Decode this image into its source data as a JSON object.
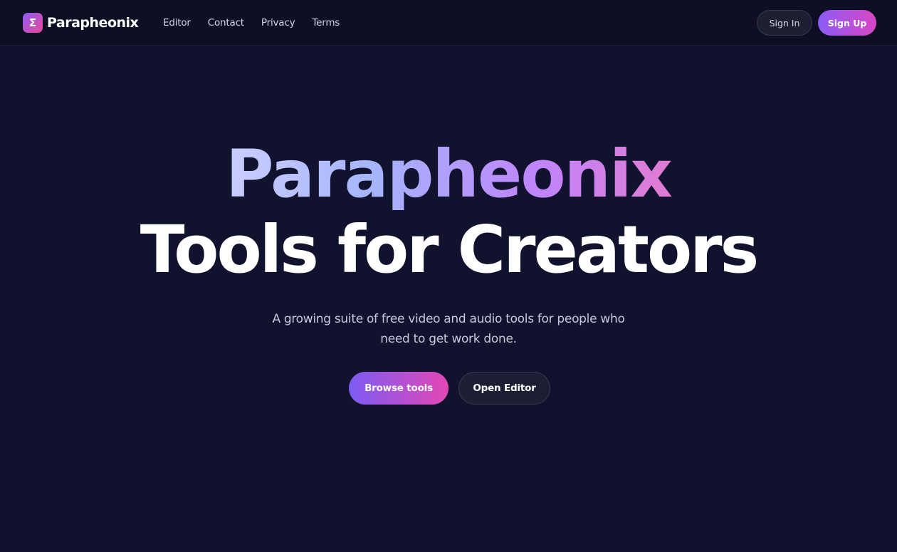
{
  "brand": {
    "logo_glyph": "Σ",
    "name": "Parapheonix",
    "logo_gradient": [
      "#8b5cf6",
      "#ec4899"
    ]
  },
  "nav": {
    "items": [
      {
        "label": "Editor"
      },
      {
        "label": "Contact"
      },
      {
        "label": "Privacy"
      },
      {
        "label": "Terms"
      }
    ]
  },
  "auth": {
    "sign_in_label": "Sign In",
    "sign_up_label": "Sign Up"
  },
  "hero": {
    "title_line_1": "Parapheonix",
    "title_line_2": "Tools for Creators",
    "subtitle": "A growing suite of free video and audio tools for people who need to get work done.",
    "primary_cta": "Browse tools",
    "secondary_cta": "Open Editor"
  },
  "colors": {
    "background": "#11132e",
    "header_background": "#0d1024",
    "accent_start": "#8b5cf6",
    "accent_end": "#ec4899"
  }
}
